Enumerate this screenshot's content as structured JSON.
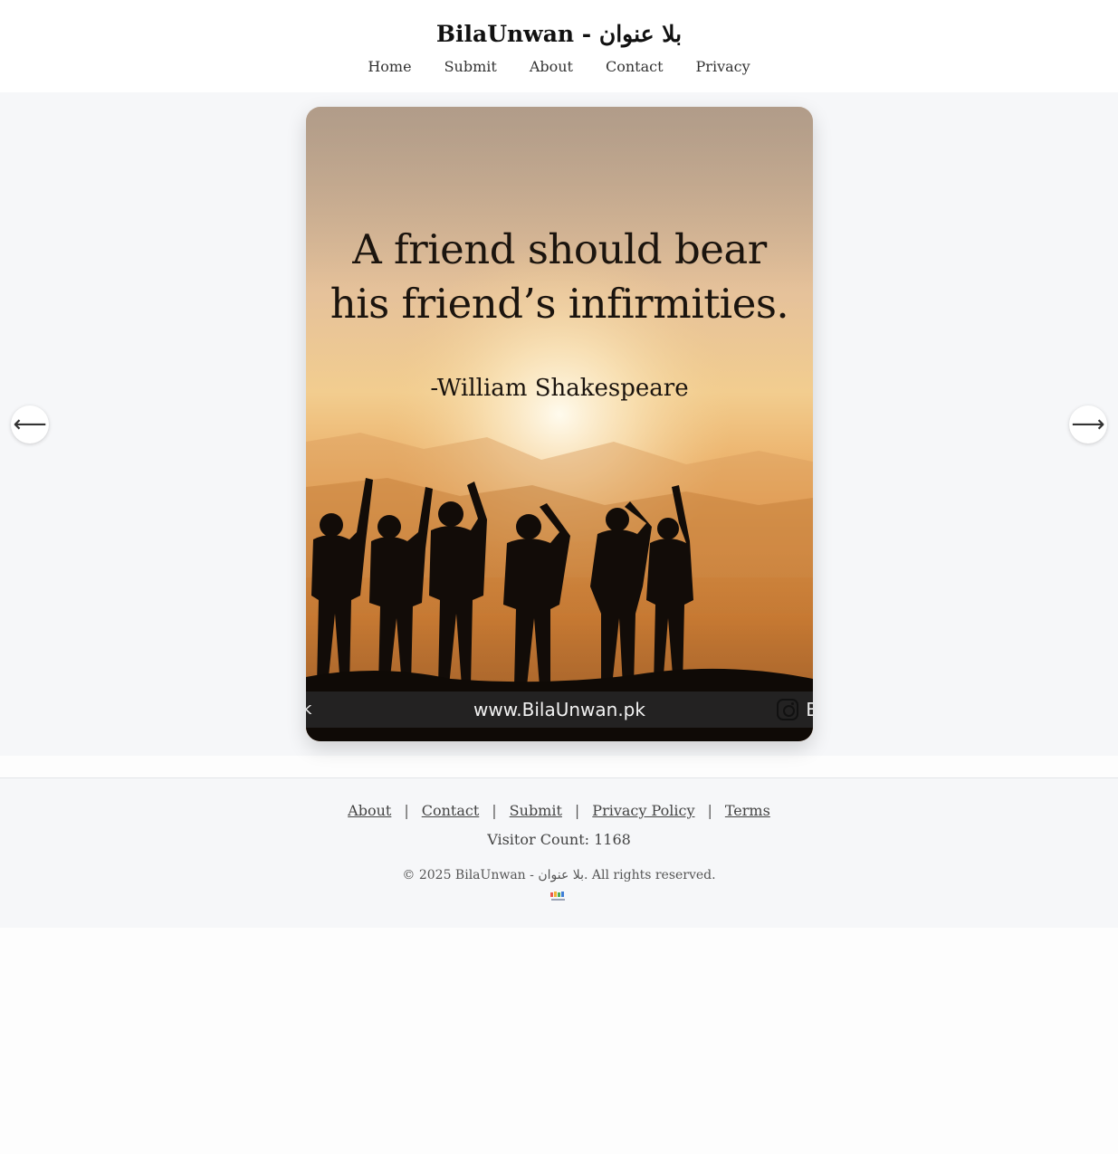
{
  "header": {
    "title": "BilaUnwan - بلا عنوان",
    "nav": [
      "Home",
      "Submit",
      "About",
      "Contact",
      "Privacy"
    ]
  },
  "carousel": {
    "slide": {
      "quote_lines": [
        "A friend should bear",
        "his friend’s infirmities."
      ],
      "author": "-William Shakespeare",
      "watermark_url": "www.BilaUnwan.pk",
      "watermark_left": "k",
      "watermark_right": "B"
    },
    "prev_label": "⟵",
    "next_label": "⟶"
  },
  "footer": {
    "links": [
      "About",
      "Contact",
      "Submit",
      "Privacy Policy",
      "Terms"
    ],
    "separator": "|",
    "visitor_count": "Visitor Count: 1168",
    "copyright": "© 2025 BilaUnwan - بلا عنوان. All rights reserved."
  },
  "colors": {
    "page_bg": "#fdfdfd",
    "section_bg": "#f6f7f9",
    "text": "#222222"
  },
  "icons": {
    "prev": "arrow-left-icon",
    "next": "arrow-right-icon",
    "instagram": "instagram-icon",
    "footer_logo": "site-logo-icon"
  }
}
